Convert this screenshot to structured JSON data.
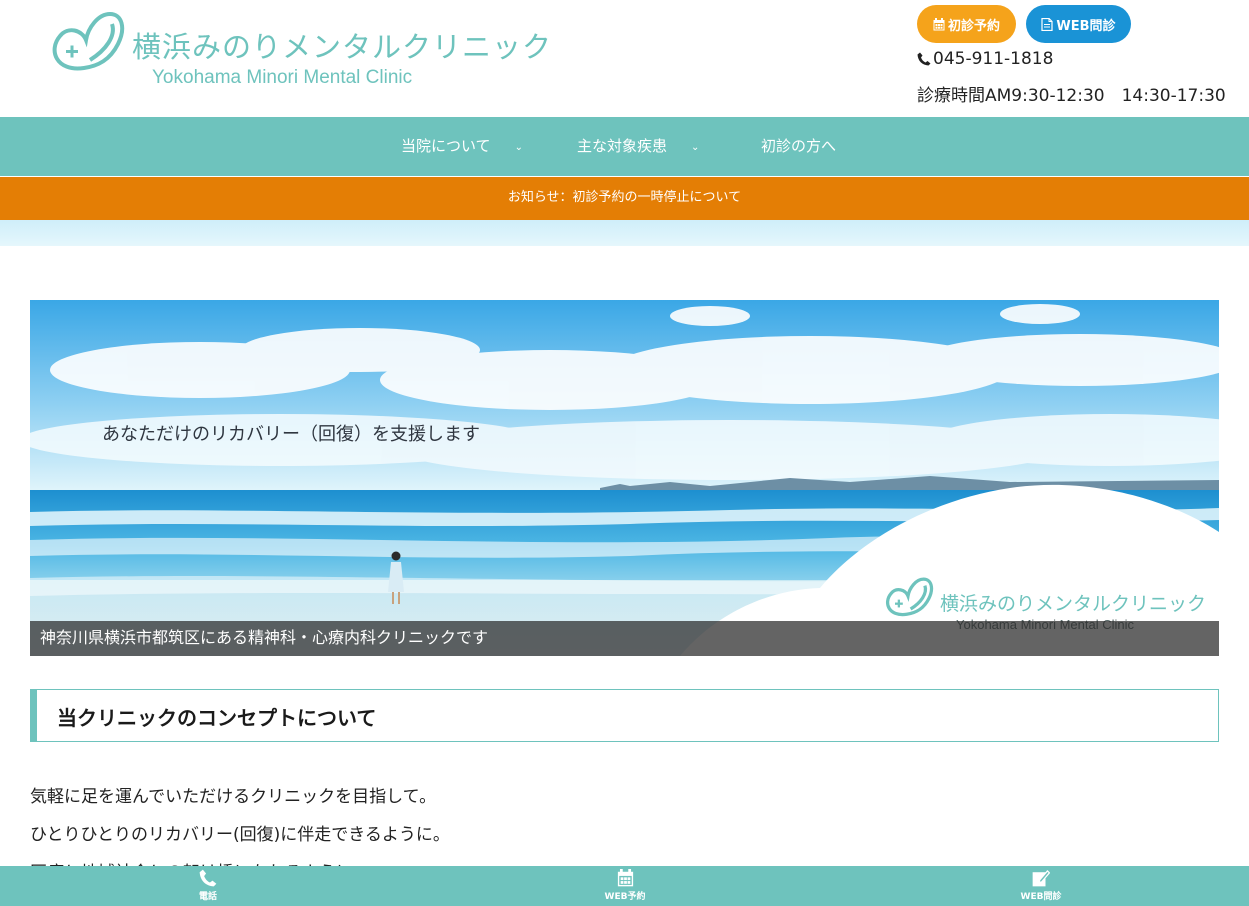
{
  "header": {
    "logo_jp": "横浜みのりメンタルクリニック",
    "logo_en": "Yokohama Minori Mental Clinic",
    "btn_first_visit": "初診予約",
    "btn_web_questionnaire": "WEB問診",
    "phone": "045-911-1818",
    "hours": "診療時間AM9:30-12:30　14:30-17:30"
  },
  "nav": {
    "items": [
      {
        "label": "当院について",
        "chevron": "⌄"
      },
      {
        "label": "主な対象疾患",
        "chevron": "⌄"
      },
      {
        "label": "初診の方へ"
      }
    ]
  },
  "notice": {
    "text": "お知らせ：初診予約の一時停止について"
  },
  "hero": {
    "catch": "あなただけのリカバリー（回復）を支援します",
    "caption": "神奈川県横浜市都筑区にある精神科・心療内科クリニックです",
    "logo_jp": "横浜みのりメンタルクリニック",
    "logo_en": "Yokohama Minori Mental Clinic"
  },
  "concept": {
    "heading": "当クリニックのコンセプトについて",
    "lines": [
      "気軽に足を運んでいただけるクリニックを目指して。",
      "ひとりひとりのリカバリー(回復)に伴走できるように。",
      "医療と地域社会との架け橋になれるように。"
    ]
  },
  "bottom_bar": {
    "items": [
      {
        "label": "電話",
        "icon": "phone-icon"
      },
      {
        "label": "WEB予約",
        "icon": "calendar-icon"
      },
      {
        "label": "WEB問診",
        "icon": "edit-icon"
      }
    ]
  },
  "colors": {
    "teal": "#6ec3bd",
    "orange_notice": "#e47e05",
    "orange_button": "#f5a31b",
    "blue_button": "#1a93d6"
  }
}
